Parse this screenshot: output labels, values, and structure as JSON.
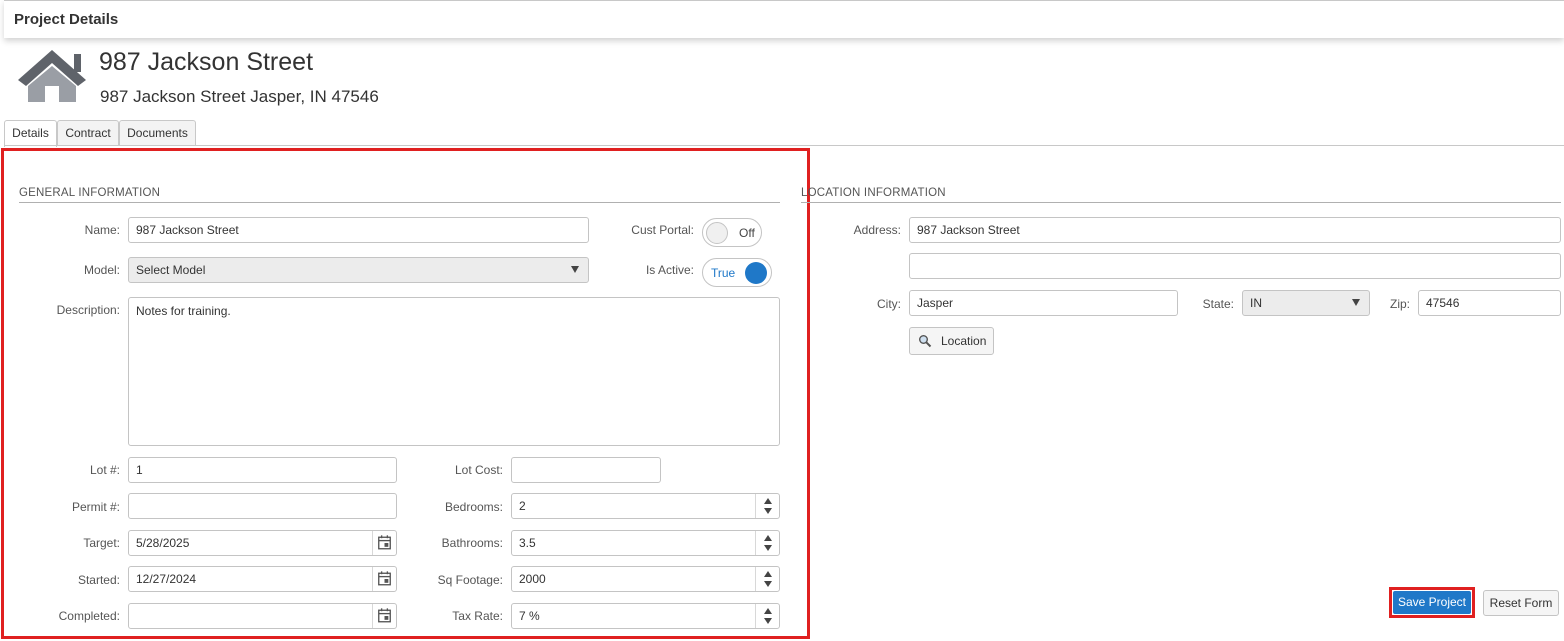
{
  "header": {
    "title": "Project Details"
  },
  "project": {
    "icon": "house-icon",
    "name": "987 Jackson Street",
    "full_address": "987 Jackson Street Jasper, IN 47546"
  },
  "tabs": [
    {
      "label": "Details",
      "active": true
    },
    {
      "label": "Contract",
      "active": false
    },
    {
      "label": "Documents",
      "active": false
    }
  ],
  "general": {
    "section_title": "GENERAL INFORMATION",
    "name_label": "Name:",
    "name_value": "987 Jackson Street",
    "cust_portal_label": "Cust Portal:",
    "cust_portal_state": "Off",
    "model_label": "Model:",
    "model_value": "Select Model",
    "is_active_label": "Is Active:",
    "is_active_state": "True",
    "description_label": "Description:",
    "description_value": "Notes for training.",
    "lot_label": "Lot #:",
    "lot_value": "1",
    "lot_cost_label": "Lot Cost:",
    "lot_cost_value": "",
    "permit_label": "Permit #:",
    "permit_value": "",
    "bedrooms_label": "Bedrooms:",
    "bedrooms_value": "2",
    "target_label": "Target:",
    "target_value": "5/28/2025",
    "bathrooms_label": "Bathrooms:",
    "bathrooms_value": "3.5",
    "started_label": "Started:",
    "started_value": "12/27/2024",
    "sqft_label": "Sq Footage:",
    "sqft_value": "2000",
    "completed_label": "Completed:",
    "completed_value": "",
    "tax_label": "Tax Rate:",
    "tax_value": "7 %"
  },
  "location": {
    "section_title": "LOCATION INFORMATION",
    "address_label": "Address:",
    "address_value": "987 Jackson Street",
    "address2_value": "",
    "city_label": "City:",
    "city_value": "Jasper",
    "state_label": "State:",
    "state_value": "IN",
    "zip_label": "Zip:",
    "zip_value": "47546",
    "location_button": "Location"
  },
  "actions": {
    "save_label": "Save Project",
    "reset_label": "Reset Form"
  },
  "colors": {
    "accent": "#1f78c8",
    "highlight": "#e02020",
    "house": "#6d7178"
  }
}
